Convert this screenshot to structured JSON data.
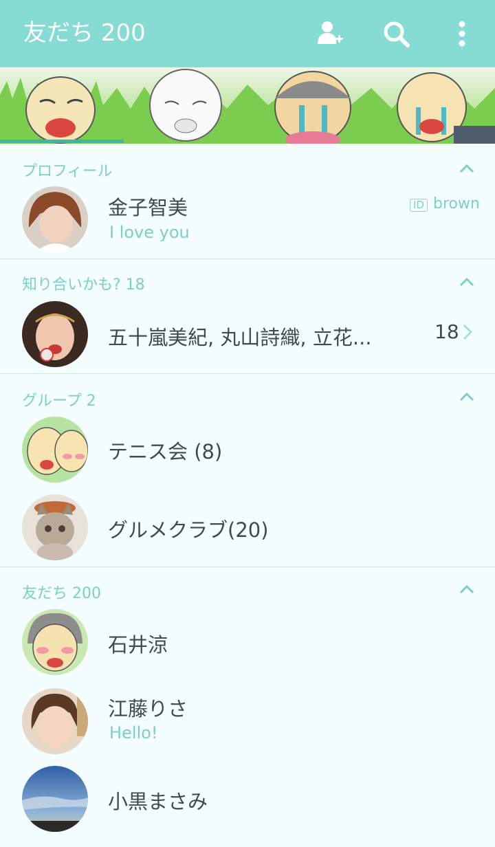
{
  "header": {
    "title": "友だち 200",
    "icons": [
      "add-friend-icon",
      "search-icon",
      "more-vert-icon"
    ]
  },
  "sections": {
    "profile": {
      "label": "プロフィール",
      "name": "金子智美",
      "status": "I love you",
      "id_badge": "ID",
      "id_value": "brown"
    },
    "suggestions": {
      "label": "知り合いかも? 18",
      "names": "五十嵐美紀, 丸山詩織, 立花...",
      "count": "18"
    },
    "groups": {
      "label": "グループ  2",
      "items": [
        {
          "name": "テニス会 (8)"
        },
        {
          "name": "グルメクラブ(20)"
        }
      ]
    },
    "friends": {
      "label": "友だち 200",
      "items": [
        {
          "name": "石井涼",
          "status": ""
        },
        {
          "name": "江藤りさ",
          "status": "Hello!"
        },
        {
          "name": "小黒まさみ",
          "status": ""
        }
      ]
    }
  },
  "colors": {
    "header": "#86dbd2",
    "accent": "#7bcfc6",
    "background": "#f4fefe",
    "text": "#3f4a4a"
  }
}
